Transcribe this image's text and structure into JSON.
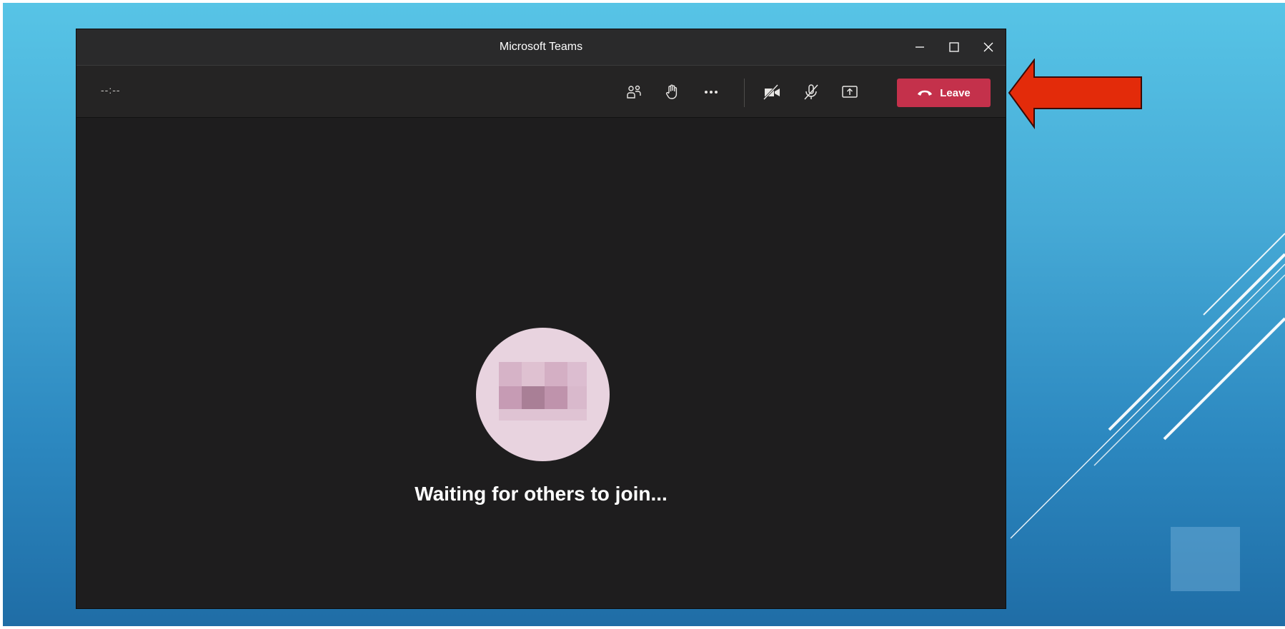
{
  "window": {
    "title": "Microsoft Teams",
    "controls": [
      "minimize-icon",
      "maximize-icon",
      "close-icon"
    ]
  },
  "meeting_bar": {
    "timer": "--:--",
    "tools": [
      "participants-icon",
      "raise-hand-icon",
      "more-options-icon",
      "camera-off-icon",
      "mic-off-icon",
      "share-screen-icon"
    ],
    "leave_label": "Leave",
    "leave_color": "#c4314b"
  },
  "stage": {
    "status_text": "Waiting for others to join..."
  },
  "colors": {
    "window_bg": "#1e1d1e",
    "titlebar_bg": "#2a2a2b",
    "slide_gradient_top": "#57c4e6",
    "slide_gradient_bottom": "#1f6da6",
    "annotation_arrow": "#e32b0a",
    "avatar_bg": "#e8d3df"
  }
}
